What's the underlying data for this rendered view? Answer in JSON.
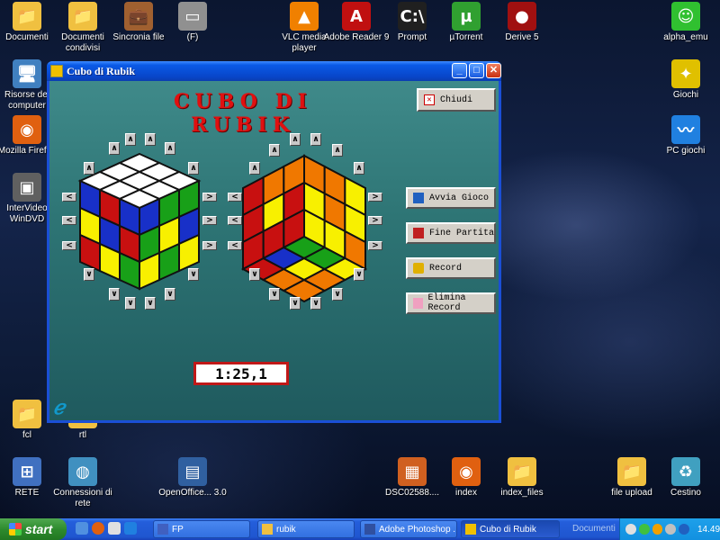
{
  "desktop": {
    "icons": [
      {
        "label": "Documenti",
        "color": "#f0c040",
        "glyph": "📁"
      },
      {
        "label": "Documenti condivisi",
        "color": "#f0c040",
        "glyph": "📁"
      },
      {
        "label": "Sincronia file",
        "color": "#a06030",
        "glyph": "💼"
      },
      {
        "label": "(F)",
        "color": "#909090",
        "glyph": "▭"
      },
      {
        "label": "VLC media player",
        "color": "#f08000",
        "glyph": "▲"
      },
      {
        "label": "Adobe Reader 9",
        "color": "#c01010",
        "glyph": "A"
      },
      {
        "label": "Prompt",
        "color": "#202020",
        "glyph": "C:\\"
      },
      {
        "label": "µTorrent",
        "color": "#30a030",
        "glyph": "µ"
      },
      {
        "label": "Derive 5",
        "color": "#a01010",
        "glyph": "●"
      },
      {
        "label": "alpha_emu",
        "color": "#30c030",
        "glyph": "☺"
      },
      {
        "label": "Risorse del computer",
        "color": "#4080c0",
        "glyph": "🖥"
      },
      {
        "label": "Giochi",
        "color": "#e0c000",
        "glyph": "✦"
      },
      {
        "label": "Mozilla Firefox",
        "color": "#e06010",
        "glyph": "◉"
      },
      {
        "label": "PC giochi",
        "color": "#2080e0",
        "glyph": "〰"
      },
      {
        "label": "InterVideo WinDVD",
        "color": "#606060",
        "glyph": "▣"
      },
      {
        "label": "fcl",
        "color": "#f0c040",
        "glyph": "📁"
      },
      {
        "label": "rtl",
        "color": "#f0c040",
        "glyph": "📁"
      },
      {
        "label": "RETE",
        "color": "#4070c0",
        "glyph": "⊞"
      },
      {
        "label": "Connessioni di rete",
        "color": "#4090c0",
        "glyph": "◍"
      },
      {
        "label": "OpenOffice... 3.0",
        "color": "#3060a0",
        "glyph": "▤"
      },
      {
        "label": "DSC02588....",
        "color": "#d06020",
        "glyph": "▦"
      },
      {
        "label": "index",
        "color": "#e06010",
        "glyph": "◉"
      },
      {
        "label": "index_files",
        "color": "#f0c040",
        "glyph": "📁"
      },
      {
        "label": "file upload",
        "color": "#f0c040",
        "glyph": "📁"
      },
      {
        "label": "Cestino",
        "color": "#40a0c0",
        "glyph": "♻"
      }
    ]
  },
  "window": {
    "title": "Cubo di Rubik",
    "minimize": "_",
    "maximize": "□",
    "close": "✕",
    "game_title": "CUBO DI RUBIK",
    "buttons": {
      "chiudi": "Chiudi",
      "avvia": "Avvia Gioco",
      "fine": "Fine Partita",
      "record": "Record",
      "elimina": "Elimina Record"
    },
    "timer": "1:25,1",
    "colors": {
      "red": "#c81010",
      "orange": "#f07800",
      "yellow": "#f8f000",
      "green": "#18a018",
      "blue": "#1830c8",
      "white": "#ffffff"
    },
    "cube_front": {
      "top": [
        "white",
        "white",
        "white",
        "white",
        "white",
        "white",
        "white",
        "white",
        "white"
      ],
      "left": [
        "blue",
        "red",
        "blue",
        "yellow",
        "blue",
        "red",
        "red",
        "yellow",
        "green"
      ],
      "right": [
        "blue",
        "green",
        "green",
        "green",
        "yellow",
        "blue",
        "yellow",
        "green",
        "yellow"
      ]
    },
    "cube_back": {
      "left": [
        "red",
        "orange",
        "orange",
        "red",
        "yellow",
        "red",
        "red",
        "red",
        "red"
      ],
      "right": [
        "orange",
        "orange",
        "yellow",
        "yellow",
        "orange",
        "yellow",
        "yellow",
        "yellow",
        "orange"
      ],
      "bottom": [
        "red",
        "blue",
        "green",
        "orange",
        "yellow",
        "green",
        "orange",
        "orange",
        "yellow"
      ]
    },
    "arrows": {
      "up": "∧",
      "down": "∨",
      "left": "<",
      "right": ">"
    }
  },
  "taskbar": {
    "start": "start",
    "tasks": [
      {
        "label": "FP",
        "color": "#4060c0"
      },
      {
        "label": "rubik",
        "color": "#f0c040"
      },
      {
        "label": "Adobe Photoshop ...",
        "color": "#3050a0"
      },
      {
        "label": "Cubo di Rubik",
        "color": "#f0c000"
      }
    ],
    "docs_label": "Documenti",
    "clock": "14.49"
  }
}
